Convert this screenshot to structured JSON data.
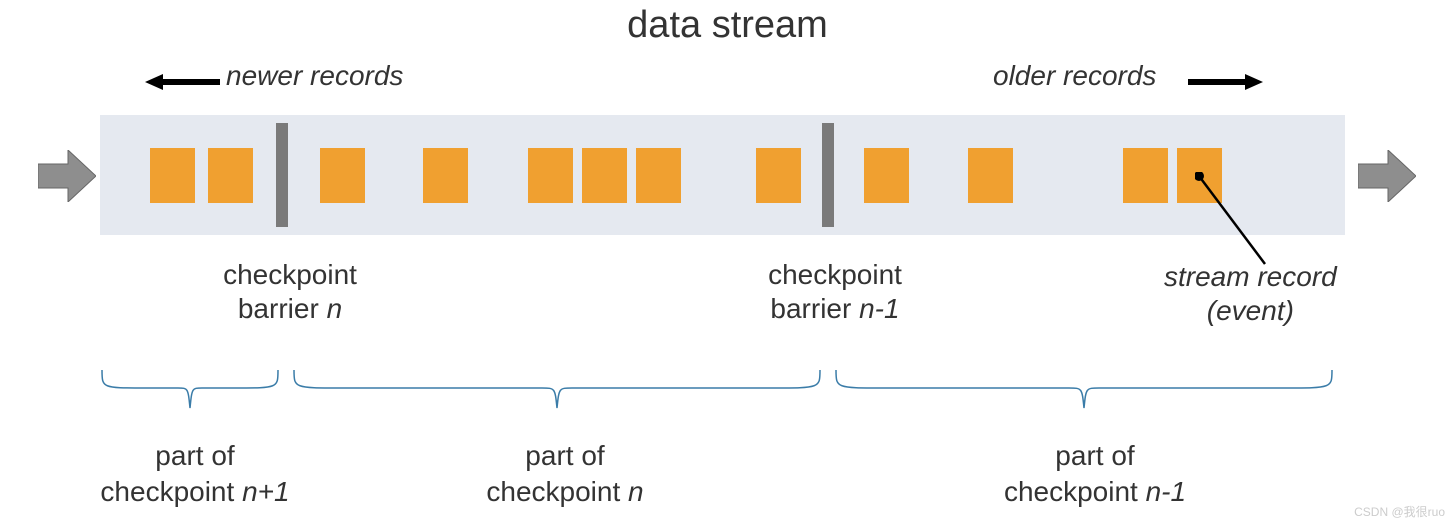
{
  "title": "data stream",
  "labels": {
    "newer": "newer records",
    "older": "older records",
    "stream_record": "stream record",
    "event": "(event)"
  },
  "checkpoints": {
    "left": {
      "line1": "checkpoint",
      "line2_prefix": "barrier ",
      "n": "n"
    },
    "right": {
      "line1": "checkpoint",
      "line2_prefix": "barrier ",
      "n": "n-1"
    }
  },
  "parts": {
    "left": {
      "line1": "part of",
      "line2_prefix": "checkpoint ",
      "n": "n+1"
    },
    "mid": {
      "line1": "part of",
      "line2_prefix": "checkpoint ",
      "n": "n"
    },
    "right": {
      "line1": "part of",
      "line2_prefix": "checkpoint ",
      "n": "n-1"
    }
  },
  "watermark": "CSDN @我很ruo"
}
